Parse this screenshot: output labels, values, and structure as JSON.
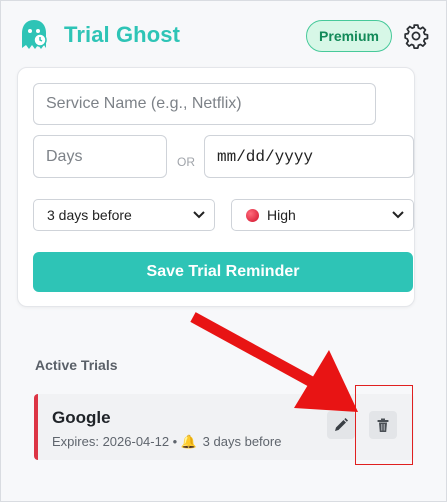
{
  "header": {
    "title": "Trial Ghost",
    "premium_label": "Premium"
  },
  "form": {
    "service_placeholder": "Service Name (e.g., Netflix)",
    "days_placeholder": "Days",
    "or_label": "OR",
    "date_value": "mm/dd/yyyy",
    "remind_selected": "3 days before",
    "priority_selected": "High",
    "save_label": "Save Trial Reminder"
  },
  "trials": {
    "section_title": "Active Trials",
    "items": [
      {
        "name": "Google",
        "expires_label": "Expires: 2026-04-12 •",
        "remind": "3 days before"
      }
    ]
  },
  "colors": {
    "accent": "#2ec4b6",
    "premium_bg": "#d7f7e7",
    "priority_high": "#dc3545",
    "annotation": "#e02020"
  },
  "icons": [
    "ghost-logo-icon",
    "gear-icon",
    "chevron-down-icon",
    "red-dot-icon",
    "bell-icon",
    "pencil-icon",
    "trash-icon",
    "annotation-arrow"
  ]
}
